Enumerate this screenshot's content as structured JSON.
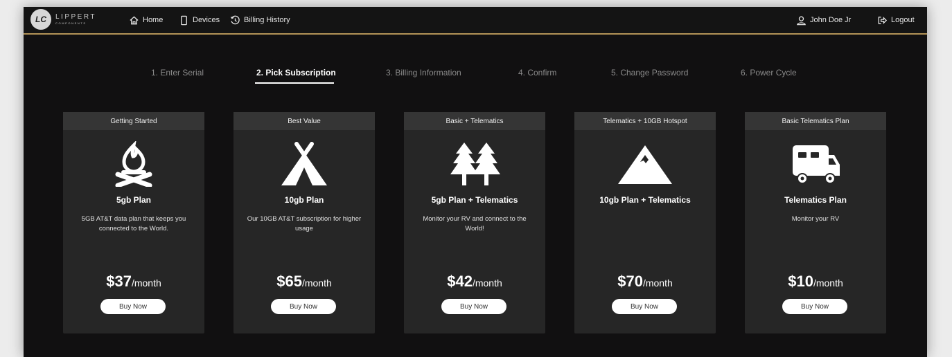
{
  "brand": {
    "name_line1": "LIPPERT",
    "name_line2": "COMPONENTS",
    "monogram": "LC"
  },
  "nav": {
    "home": "Home",
    "devices": "Devices",
    "billing_history": "Billing History",
    "user": "John Doe Jr",
    "logout": "Logout"
  },
  "steps": [
    {
      "label": "1. Enter Serial"
    },
    {
      "label": "2. Pick Subscription",
      "active": true
    },
    {
      "label": "3. Billing Information"
    },
    {
      "label": "4. Confirm"
    },
    {
      "label": "5. Change Password"
    },
    {
      "label": "6. Power Cycle"
    }
  ],
  "plans": [
    {
      "header": "Getting Started",
      "icon": "campfire-icon",
      "title": "5gb Plan",
      "description": "5GB AT&T data plan that keeps you connected to the World.",
      "price": "$37",
      "period": "/month",
      "button": "Buy Now"
    },
    {
      "header": "Best Value",
      "icon": "tent-icon",
      "title": "10gb Plan",
      "description": "Our 10GB AT&T subscription for higher usage",
      "price": "$65",
      "period": "/month",
      "button": "Buy Now"
    },
    {
      "header": "Basic + Telematics",
      "icon": "trees-icon",
      "title": "5gb Plan + Telematics",
      "description": "Monitor your RV and connect to the World!",
      "price": "$42",
      "period": "/month",
      "button": "Buy Now"
    },
    {
      "header": "Telematics + 10GB Hotspot",
      "icon": "mountain-icon",
      "title": "10gb Plan + Telematics",
      "description": "",
      "price": "$70",
      "period": "/month",
      "button": "Buy Now"
    },
    {
      "header": "Basic Telematics Plan",
      "icon": "rv-icon",
      "title": "Telematics Plan",
      "description": "Monitor your RV",
      "price": "$10",
      "period": "/month",
      "button": "Buy Now"
    }
  ],
  "colors": {
    "background": "#111011",
    "card": "#262626",
    "card_header": "#353535",
    "accent_line": "#b39357"
  }
}
